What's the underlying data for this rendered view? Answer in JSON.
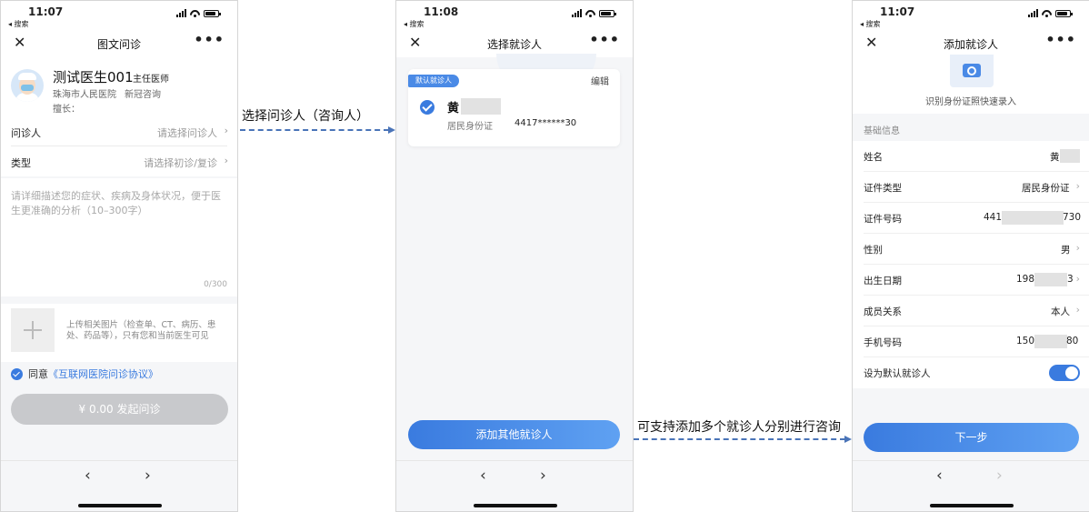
{
  "phone1": {
    "status": {
      "time": "11:07",
      "back": "◂ 搜索"
    },
    "nav": {
      "close": "✕",
      "title": "图文问诊",
      "more": "•••"
    },
    "doctor": {
      "name": "测试医生001",
      "rank": "主任医师",
      "hospital": "珠海市人民医院",
      "department": "新冠咨询",
      "specialty": "擅长："
    },
    "fields": {
      "patient_label": "问诊人",
      "patient_placeholder": "请选择问诊人",
      "type_label": "类型",
      "type_placeholder": "请选择初诊/复诊",
      "chevron": "›"
    },
    "description": {
      "placeholder": "请详细描述您的症状、疾病及身体状况，便于医生更准确的分析（10–300字）",
      "counter": "0/300"
    },
    "upload": {
      "hint": "上传相关图片（检查单、CT、病历、患处、药品等），只有您和当前医生可见"
    },
    "agreement": {
      "prefix": "同意",
      "link": "《互联网医院问诊协议》"
    },
    "submit": "¥ 0.00 发起问诊",
    "bottom": {
      "back": "‹",
      "forward": "›"
    }
  },
  "annotation1": "选择问诊人（咨询人）",
  "phone2": {
    "status": {
      "time": "11:08",
      "back": "◂ 搜索"
    },
    "nav": {
      "close": "✕",
      "title": "选择就诊人",
      "more": "•••"
    },
    "card": {
      "tag": "默认就诊人",
      "edit": "编辑",
      "name": "黄",
      "id_label": "居民身份证",
      "id_number": "4417******30"
    },
    "add_button": "添加其他就诊人",
    "bottom": {
      "back": "‹",
      "forward": "›"
    }
  },
  "annotation2": "可支持添加多个就诊人分别进行咨询",
  "phone3": {
    "status": {
      "time": "11:07",
      "back": "◂ 搜索"
    },
    "nav": {
      "close": "✕",
      "title": "添加就诊人",
      "more": "•••"
    },
    "scan_text": "识别身份证照快速录入",
    "section_title": "基础信息",
    "rows": {
      "name_label": "姓名",
      "name_value": "黄",
      "idtype_label": "证件类型",
      "idtype_value": "居民身份证",
      "idnum_label": "证件号码",
      "idnum_prefix": "441",
      "idnum_suffix": "730",
      "gender_label": "性别",
      "gender_value": "男",
      "birth_label": "出生日期",
      "birth_prefix": "198",
      "birth_suffix": "3",
      "relation_label": "成员关系",
      "relation_value": "本人",
      "phone_label": "手机号码",
      "phone_prefix": "150",
      "phone_suffix": "80",
      "default_label": "设为默认就诊人",
      "chevron": "›"
    },
    "next_button": "下一步",
    "bottom": {
      "back": "‹",
      "forward": "›"
    }
  }
}
